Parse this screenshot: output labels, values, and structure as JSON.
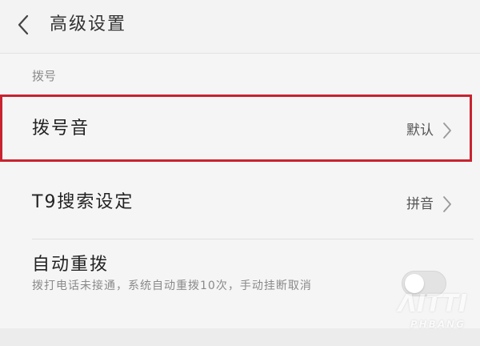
{
  "header": {
    "title": "高级设置",
    "back_icon": "chevron-left-icon"
  },
  "section": {
    "label": "拨号"
  },
  "rows": [
    {
      "title": "拨号音",
      "value": "默认",
      "icon": "chevron-right-icon",
      "highlighted": true,
      "highlight_color": "#c8232f"
    },
    {
      "title": "T9搜索设定",
      "value": "拼音",
      "icon": "chevron-right-icon"
    },
    {
      "title": "自动重拨",
      "description": "拨打电话未接通，系统自动重拨10次，手动挂断取消",
      "toggle_on": false
    }
  ],
  "watermark": {
    "main": "ΛΙΤΤΙ",
    "sub": "PHBANG"
  }
}
